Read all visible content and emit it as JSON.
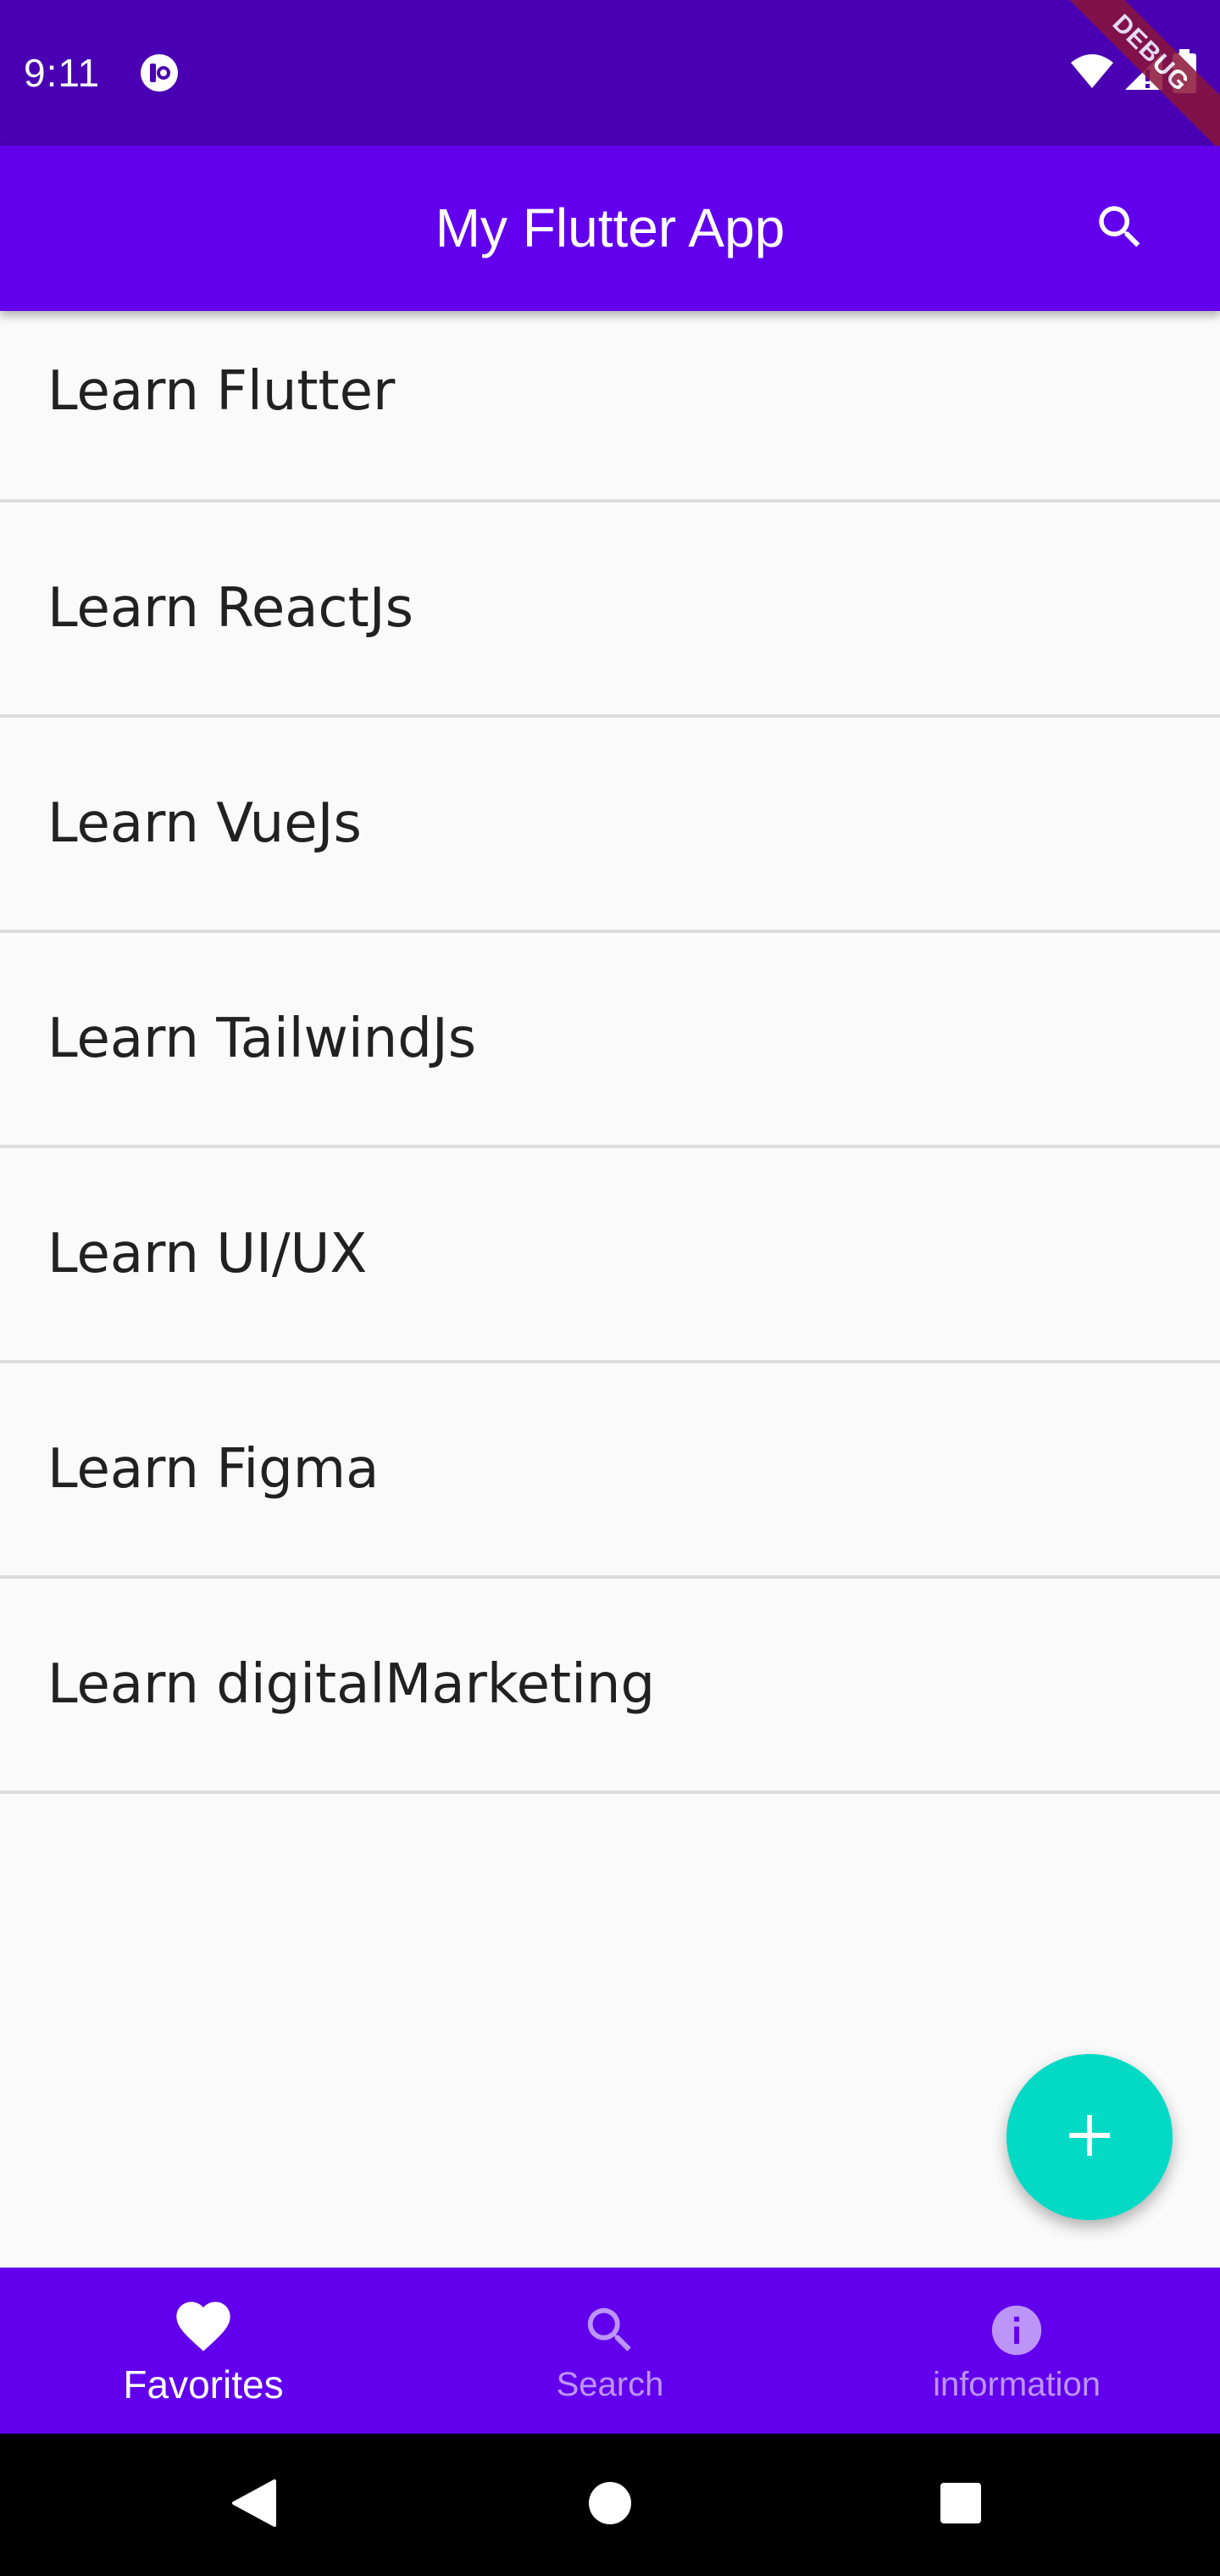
{
  "status_bar": {
    "time": "9:11",
    "debug_label": "DEBUG"
  },
  "app_bar": {
    "title": "My Flutter App",
    "search_icon": "search-icon"
  },
  "items": [
    {
      "label": "Learn Flutter"
    },
    {
      "label": "Learn ReactJs"
    },
    {
      "label": "Learn VueJs"
    },
    {
      "label": "Learn TailwindJs"
    },
    {
      "label": "Learn UI/UX"
    },
    {
      "label": "Learn Figma"
    },
    {
      "label": "Learn digitalMarketing"
    }
  ],
  "fab": {
    "icon": "plus-icon"
  },
  "bottom_nav": {
    "items": [
      {
        "label": "Favorites",
        "icon": "heart-icon",
        "active": true
      },
      {
        "label": "Search",
        "icon": "search-icon",
        "active": false
      },
      {
        "label": "information",
        "icon": "info-icon",
        "active": false
      }
    ]
  },
  "colors": {
    "status_bar": "#4a00b3",
    "primary": "#6200ee",
    "accent": "#03dac6",
    "background": "#fafafa",
    "debug_ribbon": "#8a1538"
  }
}
